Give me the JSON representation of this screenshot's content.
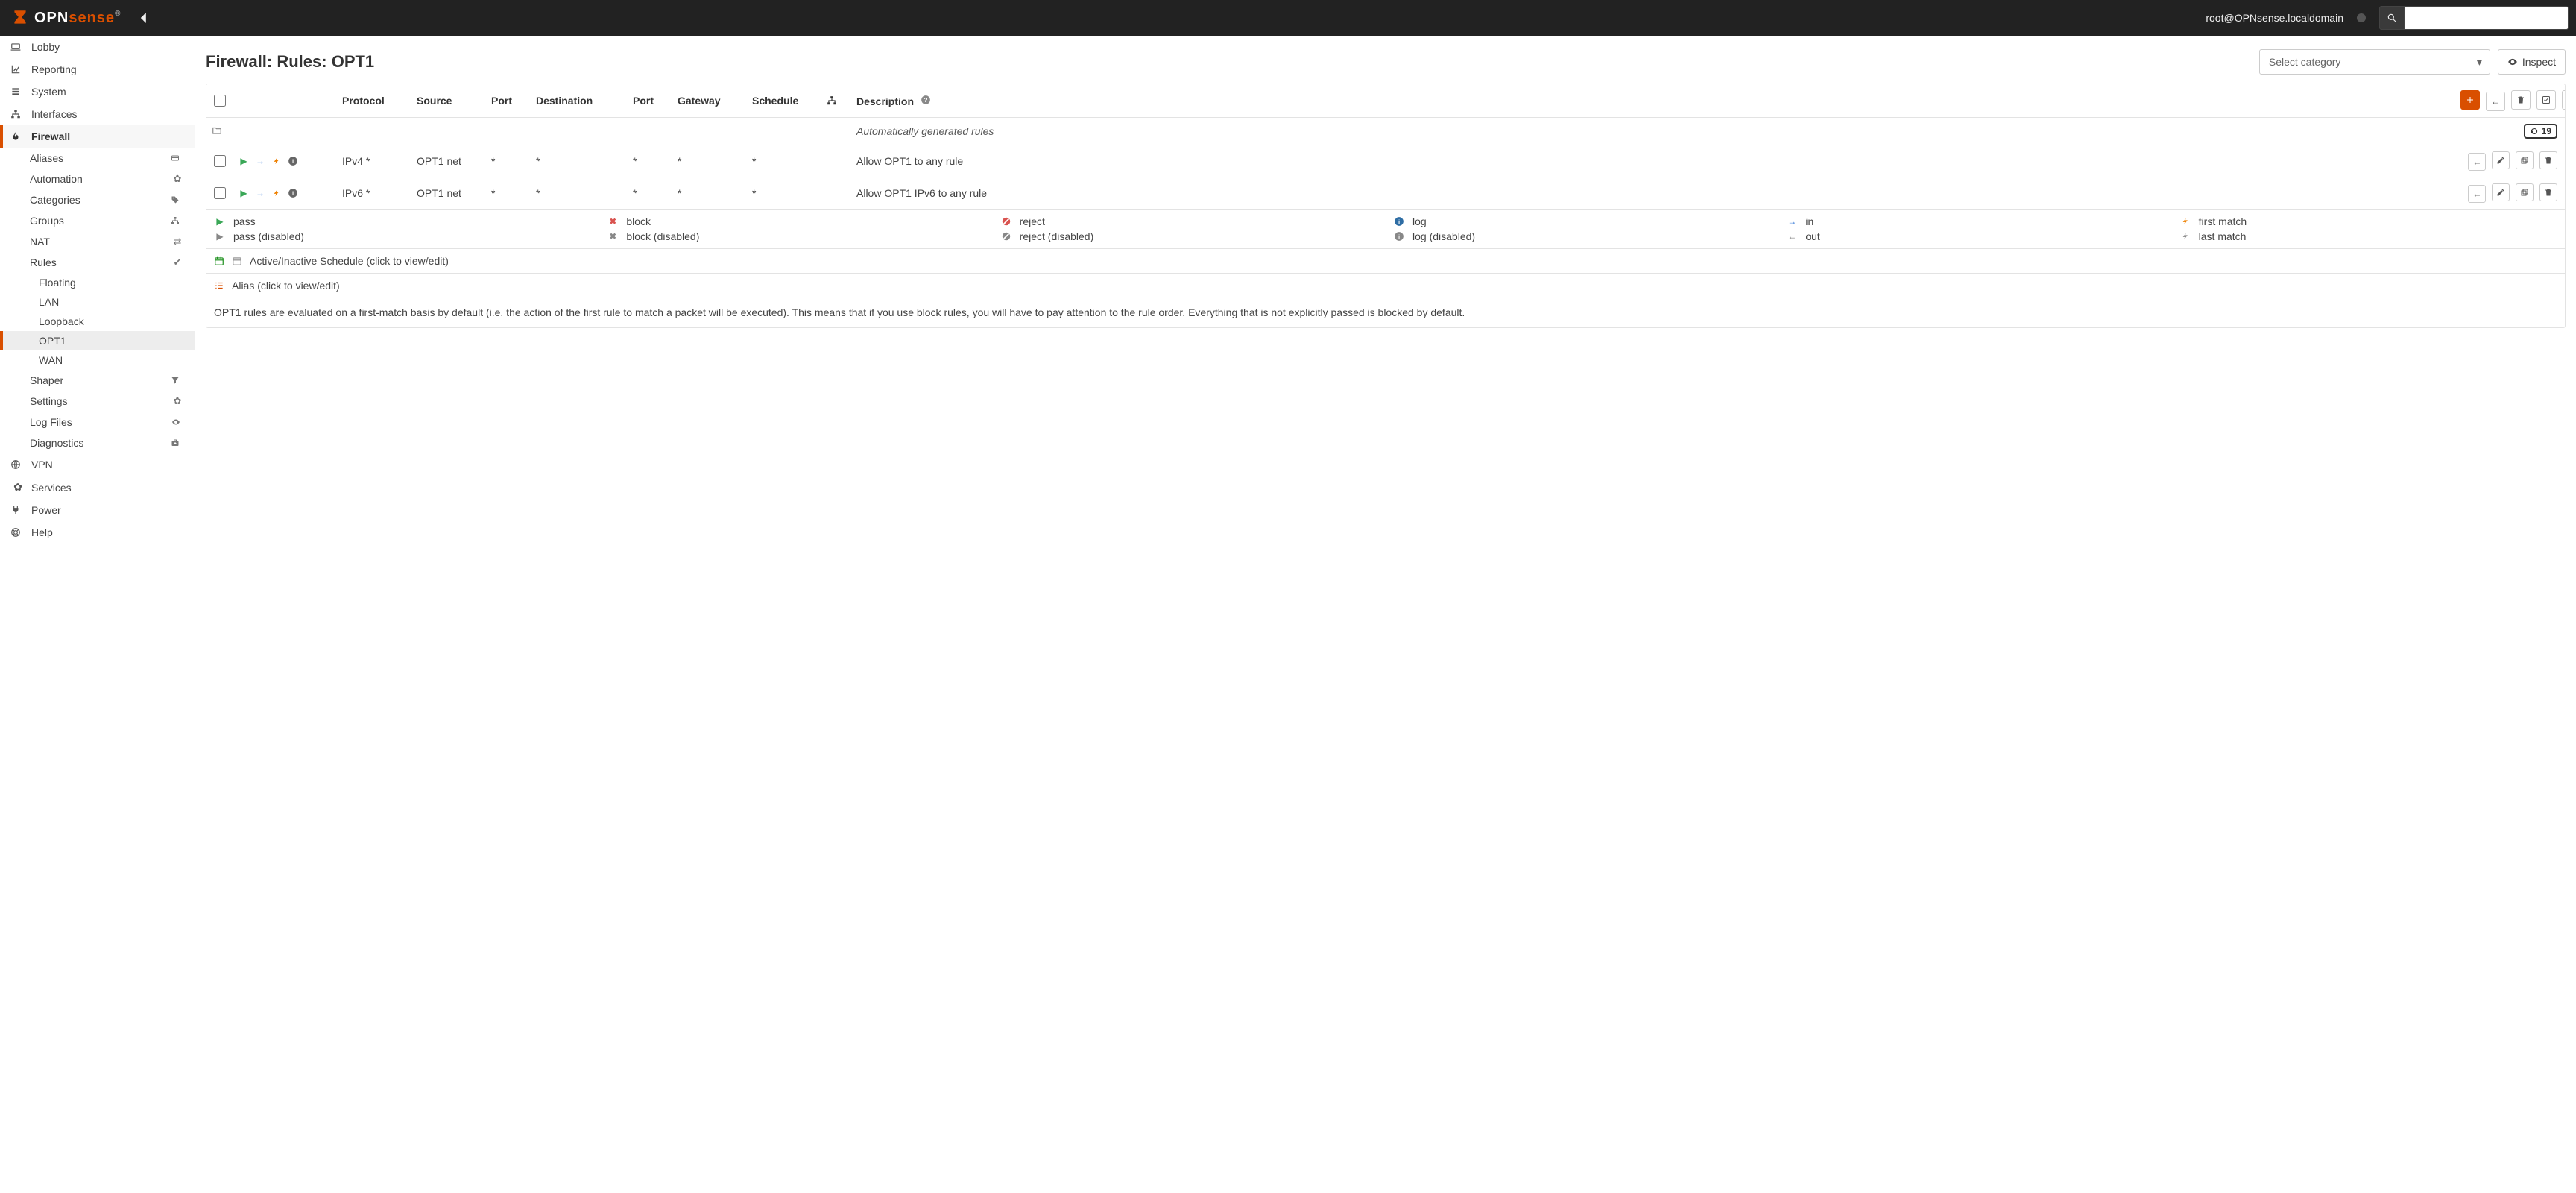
{
  "header": {
    "brand_left": "OPN",
    "brand_right": "sense",
    "reg": "®",
    "user": "root@OPNsense.localdomain",
    "search_placeholder": ""
  },
  "sidebar": {
    "top": [
      {
        "icon": "laptop",
        "label": "Lobby"
      },
      {
        "icon": "chart",
        "label": "Reporting"
      },
      {
        "icon": "layers",
        "label": "System"
      },
      {
        "icon": "sitemap",
        "label": "Interfaces"
      },
      {
        "icon": "fire",
        "label": "Firewall",
        "active": true
      },
      {
        "icon": "globe",
        "label": "VPN"
      },
      {
        "icon": "gear",
        "label": "Services"
      },
      {
        "icon": "plug",
        "label": "Power"
      },
      {
        "icon": "life-ring",
        "label": "Help"
      }
    ],
    "firewall_sub": [
      {
        "label": "Aliases",
        "ricon": "card"
      },
      {
        "label": "Automation",
        "ricon": "gear"
      },
      {
        "label": "Categories",
        "ricon": "tag"
      },
      {
        "label": "Groups",
        "ricon": "sitemap"
      },
      {
        "label": "NAT",
        "ricon": "exchange"
      },
      {
        "label": "Rules",
        "ricon": "check",
        "expanded": true,
        "children": [
          {
            "label": "Floating"
          },
          {
            "label": "LAN"
          },
          {
            "label": "Loopback"
          },
          {
            "label": "OPT1",
            "active": true
          },
          {
            "label": "WAN"
          }
        ]
      },
      {
        "label": "Shaper",
        "ricon": "filter"
      },
      {
        "label": "Settings",
        "ricon": "gears"
      },
      {
        "label": "Log Files",
        "ricon": "eye"
      },
      {
        "label": "Diagnostics",
        "ricon": "medkit"
      }
    ]
  },
  "page": {
    "title": "Firewall: Rules: OPT1",
    "select_category_placeholder": "Select category",
    "inspect_label": "Inspect"
  },
  "table": {
    "columns": {
      "protocol": "Protocol",
      "source": "Source",
      "port": "Port",
      "destination": "Destination",
      "dport": "Port",
      "gateway": "Gateway",
      "schedule": "Schedule",
      "description": "Description"
    },
    "autorow": {
      "label": "Automatically generated rules",
      "count": "19"
    },
    "rules": [
      {
        "protocol": "IPv4 *",
        "source": "OPT1 net",
        "port": "*",
        "destination": "*",
        "dport": "*",
        "gateway": "*",
        "schedule": "*",
        "description": "Allow OPT1 to any rule"
      },
      {
        "protocol": "IPv6 *",
        "source": "OPT1 net",
        "port": "*",
        "destination": "*",
        "dport": "*",
        "gateway": "*",
        "schedule": "*",
        "description": "Allow OPT1 IPv6 to any rule"
      }
    ]
  },
  "legend": {
    "row1": [
      {
        "icon": "play-green",
        "label": "pass"
      },
      {
        "icon": "x-red",
        "label": "block"
      },
      {
        "icon": "ban-red",
        "label": "reject"
      },
      {
        "icon": "info-blue",
        "label": "log"
      },
      {
        "icon": "arrow-right-blue",
        "label": "in"
      },
      {
        "icon": "bolt-orange",
        "label": "first match"
      }
    ],
    "row2": [
      {
        "icon": "play-gray",
        "label": "pass (disabled)"
      },
      {
        "icon": "x-gray",
        "label": "block (disabled)"
      },
      {
        "icon": "ban-gray",
        "label": "reject (disabled)"
      },
      {
        "icon": "info-gray",
        "label": "log (disabled)"
      },
      {
        "icon": "arrow-left-black",
        "label": "out"
      },
      {
        "icon": "bolt-gray",
        "label": "last match"
      }
    ],
    "schedule_note": "Active/Inactive Schedule (click to view/edit)",
    "alias_note": "Alias (click to view/edit)",
    "hint": "OPT1 rules are evaluated on a first-match basis by default (i.e. the action of the first rule to match a packet will be executed). This means that if you use block rules, you will have to pay attention to the rule order. Everything that is not explicitly passed is blocked by default."
  }
}
